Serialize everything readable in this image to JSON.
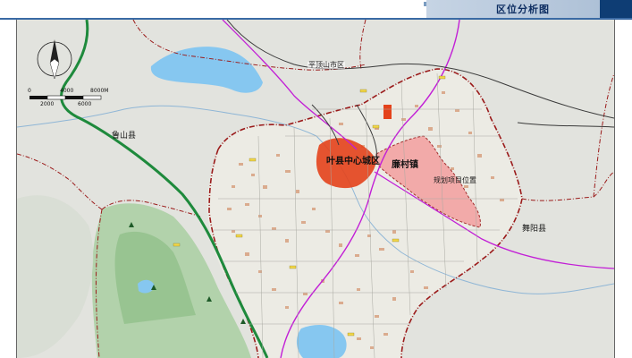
{
  "header": {
    "title": "区位分析图"
  },
  "map": {
    "labels": {
      "central_district": "叶县中心城区",
      "town": "廉村镇",
      "project_location": "规划项目位置",
      "lushan": "鲁山县",
      "wuyang": "舞阳县",
      "pingdingshan": "平顶山市区"
    },
    "scale_bar": {
      "top_values": [
        "0",
        "4000",
        "8000M"
      ],
      "bottom_values": [
        "2000",
        "6000"
      ]
    },
    "north_arrow": "north-arrow",
    "colors": {
      "boundary": "#9b1b1b",
      "project_area": "#f3a3a3",
      "central_district": "#e4421b",
      "expressway": "#1e8a3c",
      "railway": "#c21fd6",
      "water": "#86c7f0",
      "settlement": "#d9a585",
      "mountain": "#9fc99b"
    }
  }
}
